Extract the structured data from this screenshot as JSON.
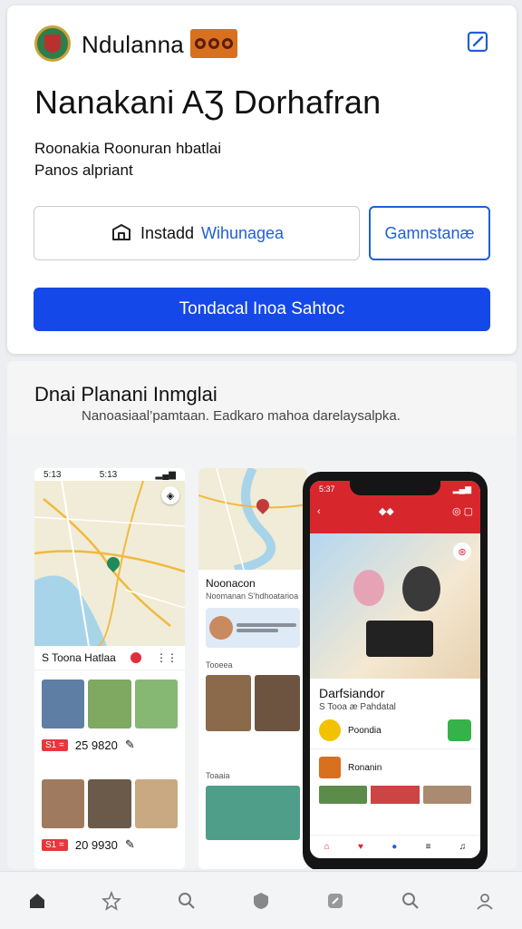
{
  "header": {
    "app_name": "Ndulanna",
    "title": "Nanakani AƷ Dorhafran",
    "subtitle_line1": "Roonakia Roonuran hbatlai",
    "subtitle_line2": "Panos alpriant"
  },
  "actions": {
    "install_prefix": "Instadd",
    "install_accent": "Wihunagea",
    "secondary_label": "Gamnstanæ",
    "primary_label": "Tondacal Inoa Sahtoc"
  },
  "preview": {
    "title": "Dnai Planani Inmglai",
    "description": "Nanoasiaal’pamtaan. Eadkaro mahoa darelaysalpka."
  },
  "screen1": {
    "time_left": "5:13",
    "time_mid": "5:13",
    "location_label": "S Toona Hatlaa",
    "count1": "25 9820",
    "count2": "20 9930",
    "tag": "S1 ="
  },
  "screen2": {
    "list_head": "Noonacon",
    "list_sub": "Noomanan S’hdhoatarioa",
    "item1": "Tooeea",
    "item2": "Toaaia"
  },
  "phone": {
    "time": "5:37",
    "title": "Darfsiandor",
    "subtitle": "S Tooa æ Pahdatal",
    "row1": "Poondia",
    "row2": "Ronanin"
  },
  "colors": {
    "accent_blue": "#1448e8",
    "brand_red": "#d8262d",
    "pin_green": "#1f8a5a"
  },
  "tabbar": {
    "icons": [
      "home-icon",
      "star-icon",
      "search-icon",
      "shield-icon",
      "tag-icon",
      "search-icon",
      "profile-icon"
    ]
  }
}
